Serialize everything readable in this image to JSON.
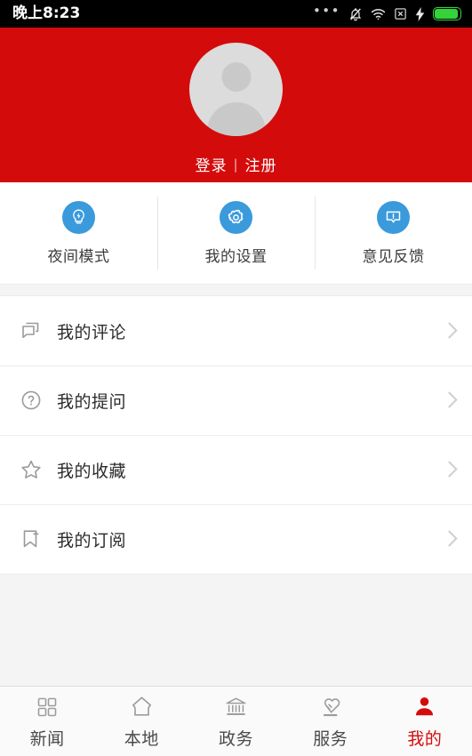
{
  "statusbar": {
    "time": "晚上8:23",
    "icons": [
      "more-dots-icon",
      "bell-muted-icon",
      "wifi-icon",
      "no-sim-icon",
      "charging-bolt-icon",
      "battery-icon"
    ]
  },
  "header": {
    "background_color": "#d40b0b",
    "avatar_icon": "user-avatar-placeholder",
    "login_label": "登录",
    "separator": "|",
    "register_label": "注册"
  },
  "quick_actions": {
    "accent_color": "#3a9adc",
    "items": [
      {
        "label": "夜间模式",
        "icon": "lightbulb-icon"
      },
      {
        "label": "我的设置",
        "icon": "gear-icon"
      },
      {
        "label": "意见反馈",
        "icon": "feedback-bubble-icon"
      }
    ]
  },
  "menu": {
    "items": [
      {
        "label": "我的评论",
        "icon": "comment-bubbles-icon",
        "chevron": "chevron-right-icon"
      },
      {
        "label": "我的提问",
        "icon": "question-circle-icon",
        "chevron": "chevron-right-icon"
      },
      {
        "label": "我的收藏",
        "icon": "star-icon",
        "chevron": "chevron-right-icon"
      },
      {
        "label": "我的订阅",
        "icon": "bookmark-plus-icon",
        "chevron": "chevron-right-icon"
      }
    ]
  },
  "tabbar": {
    "active_color": "#d40b0b",
    "inactive_color": "#9d9d9d",
    "items": [
      {
        "label": "新闻",
        "icon": "grid-icon",
        "active": false
      },
      {
        "label": "本地",
        "icon": "house-icon",
        "active": false
      },
      {
        "label": "政务",
        "icon": "government-building-icon",
        "active": false
      },
      {
        "label": "服务",
        "icon": "heart-hand-icon",
        "active": false
      },
      {
        "label": "我的",
        "icon": "person-icon",
        "active": true
      }
    ]
  }
}
